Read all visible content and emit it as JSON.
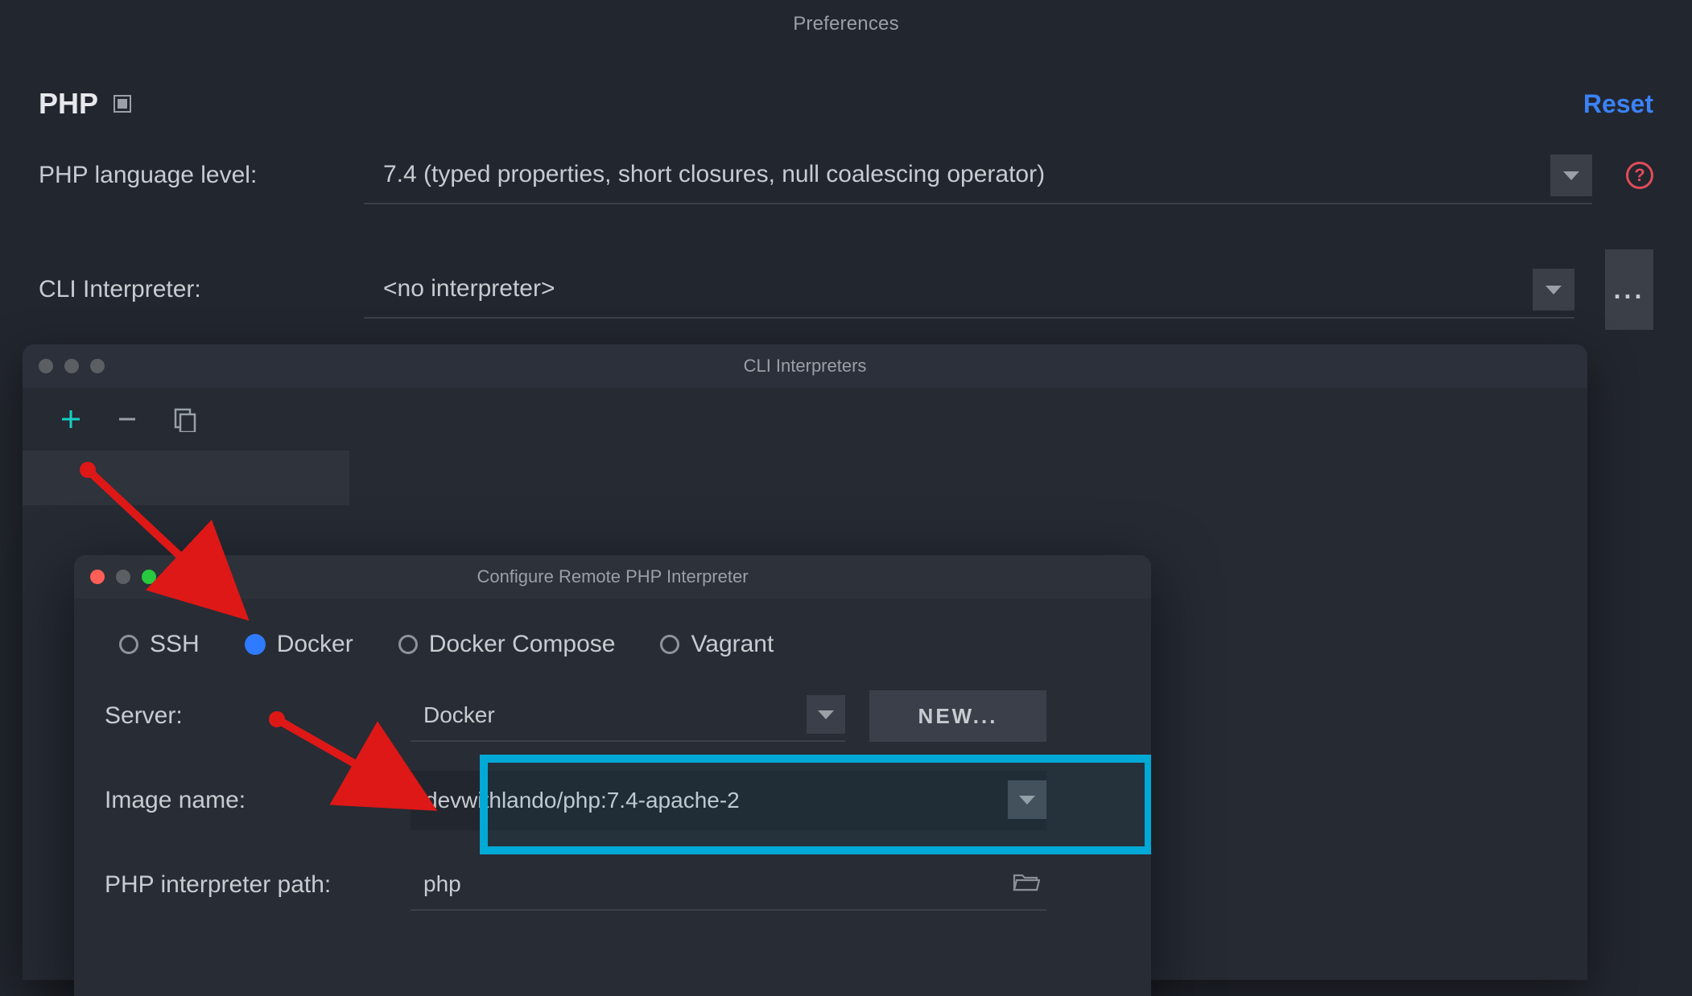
{
  "preferences": {
    "window_title": "Preferences",
    "section_title": "PHP",
    "reset_label": "Reset",
    "rows": {
      "lang_level_label": "PHP language level:",
      "lang_level_value": "7.4 (typed properties, short closures, null coalescing operator)",
      "cli_interp_label": "CLI Interpreter:",
      "cli_interp_value": "<no interpreter>"
    },
    "help_glyph": "?",
    "more_glyph": "..."
  },
  "cli_interpreters": {
    "window_title": "CLI Interpreters",
    "toolbar": {
      "add": "add",
      "remove": "remove",
      "copy": "copy"
    }
  },
  "configure_remote": {
    "window_title": "Configure Remote PHP Interpreter",
    "radios": {
      "ssh": "SSH",
      "docker": "Docker",
      "docker_compose": "Docker Compose",
      "vagrant": "Vagrant",
      "selected": "docker"
    },
    "server": {
      "label": "Server:",
      "value": "Docker",
      "new_button": "NEW..."
    },
    "image": {
      "label": "Image name:",
      "value": "devwithlando/php:7.4-apache-2"
    },
    "interp_path": {
      "label": "PHP interpreter path:",
      "value": "php"
    }
  },
  "colors": {
    "accent_blue": "#3b82f6",
    "highlight_cyan": "#00a9d6",
    "arrow_red": "#dd1817"
  }
}
